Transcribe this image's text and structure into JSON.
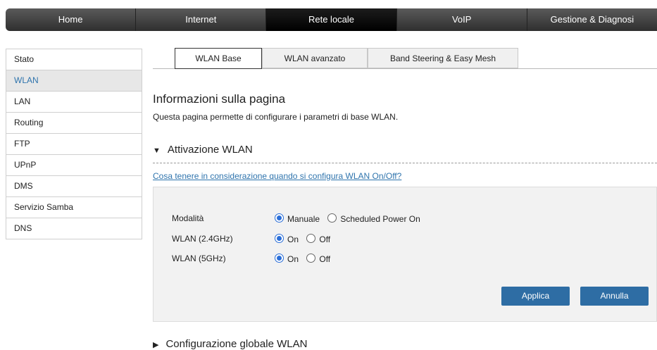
{
  "nav": {
    "items": [
      {
        "label": "Home",
        "active": false
      },
      {
        "label": "Internet",
        "active": false
      },
      {
        "label": "Rete locale",
        "active": true
      },
      {
        "label": "VoIP",
        "active": false
      },
      {
        "label": "Gestione & Diagnosi",
        "active": false
      }
    ]
  },
  "sidebar": {
    "items": [
      {
        "label": "Stato"
      },
      {
        "label": "WLAN"
      },
      {
        "label": "LAN"
      },
      {
        "label": "Routing"
      },
      {
        "label": "FTP"
      },
      {
        "label": "UPnP"
      },
      {
        "label": "DMS"
      },
      {
        "label": "Servizio Samba"
      },
      {
        "label": "DNS"
      }
    ],
    "active_index": 1
  },
  "tabs": [
    {
      "label": "WLAN Base",
      "active": true
    },
    {
      "label": "WLAN avanzato",
      "active": false
    },
    {
      "label": "Band Steering & Easy Mesh",
      "active": false
    }
  ],
  "page": {
    "title": "Informazioni sulla pagina",
    "description": "Questa pagina permette di configurare i parametri di base WLAN."
  },
  "section_wlan": {
    "title": "Attivazione WLAN",
    "expanded": true,
    "help_link": "Cosa tenere in considerazione quando si configura WLAN On/Off?"
  },
  "form": {
    "mode": {
      "label": "Modalità",
      "options": [
        "Manuale",
        "Scheduled Power On"
      ],
      "selected": "Manuale"
    },
    "wlan24": {
      "label": "WLAN (2.4GHz)",
      "options": [
        "On",
        "Off"
      ],
      "selected": "On"
    },
    "wlan5": {
      "label": "WLAN (5GHz)",
      "options": [
        "On",
        "Off"
      ],
      "selected": "On"
    },
    "apply_label": "Applica",
    "cancel_label": "Annulla"
  },
  "section_global": {
    "title": "Configurazione globale WLAN",
    "expanded": false
  },
  "colors": {
    "accent": "#2e6da4",
    "link": "#2f74ad",
    "radio": "#2a6ed8",
    "nav_bg": "#3a3a3a"
  }
}
